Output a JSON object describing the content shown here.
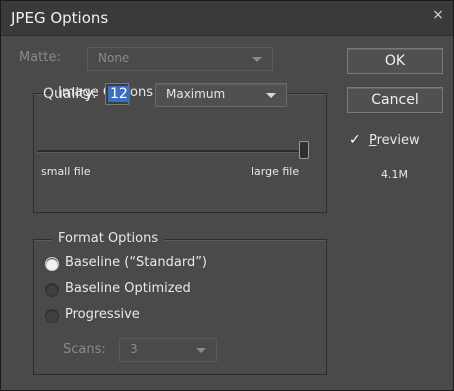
{
  "window": {
    "title": "JPEG Options",
    "close_icon": "close-icon"
  },
  "matte": {
    "label": "Matte:",
    "value": "None"
  },
  "image_options": {
    "title": "Image Options",
    "quality_label": "Quality:",
    "quality_value": "12",
    "quality_preset": "Maximum",
    "small_file_label": "small file",
    "large_file_label": "large file"
  },
  "format_options": {
    "title": "Format Options",
    "options": [
      {
        "label": "Baseline (“Standard”)",
        "checked": true
      },
      {
        "label": "Baseline Optimized",
        "checked": false
      },
      {
        "label": "Progressive",
        "checked": false
      }
    ],
    "scans_label": "Scans:",
    "scans_value": "3"
  },
  "buttons": {
    "ok": "OK",
    "cancel": "Cancel"
  },
  "preview": {
    "label_prefix": "",
    "label_underlined": "P",
    "label_rest": "review",
    "checked": true,
    "file_size": "4.1M"
  }
}
